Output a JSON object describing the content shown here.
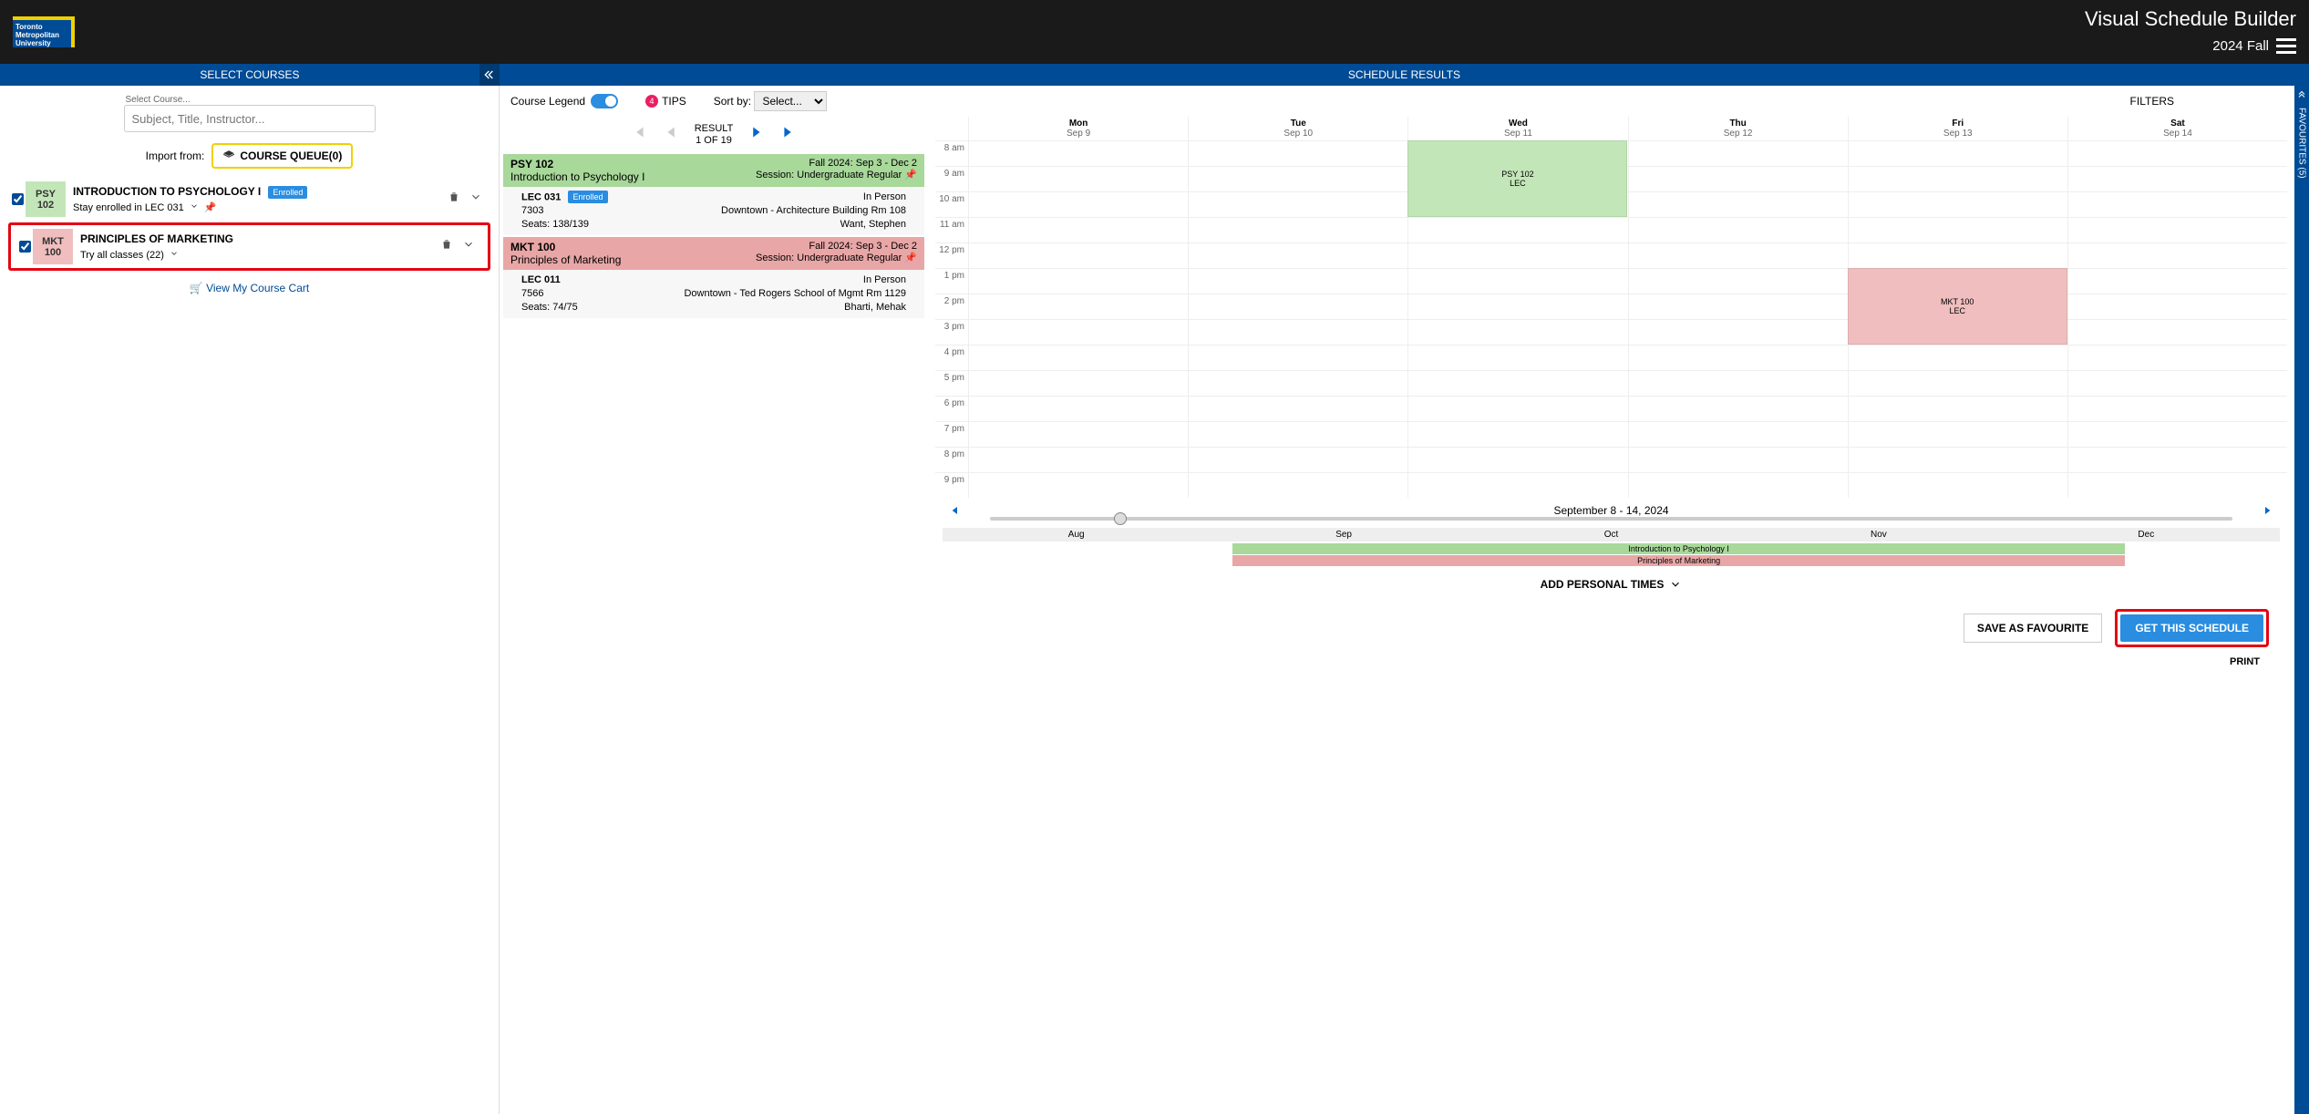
{
  "header": {
    "logo_text": "Toronto Metropolitan University",
    "app_title": "Visual Schedule Builder",
    "term": "2024 Fall"
  },
  "bluebar": {
    "left": "SELECT COURSES",
    "right": "SCHEDULE RESULTS"
  },
  "leftpanel": {
    "select_label": "Select Course...",
    "search_placeholder": "Subject, Title, Instructor...",
    "import_label": "Import from:",
    "queue_btn": "COURSE QUEUE(0)",
    "view_cart": "View My Course Cart",
    "courses": [
      {
        "code1": "PSY",
        "code2": "102",
        "title": "INTRODUCTION TO PSYCHOLOGY I",
        "enrolled": "Enrolled",
        "sub": "Stay enrolled in LEC 031",
        "badge": "badge-green"
      },
      {
        "code1": "MKT",
        "code2": "100",
        "title": "PRINCIPLES OF MARKETING",
        "enrolled": "",
        "sub": "Try all classes (22)",
        "badge": "badge-pink"
      }
    ]
  },
  "controls": {
    "legend": "Course Legend",
    "tips_count": "4",
    "tips": "TIPS",
    "sort_label": "Sort by:",
    "sort_value": "Select...",
    "filters": "FILTERS"
  },
  "pager": {
    "label": "RESULT",
    "count": "1 OF 19"
  },
  "sections": [
    {
      "head_class": "head-green",
      "code": "PSY 102",
      "name": "Introduction to Psychology I",
      "term": "Fall 2024: Sep 3 - Dec 2",
      "session": "Session: Undergraduate Regular",
      "sec": "LEC 031",
      "enrolled": "Enrolled",
      "num": "7303",
      "seats": "Seats: 138/139",
      "mode": "In Person",
      "loc": "Downtown - Architecture Building Rm 108",
      "instr": "Want, Stephen"
    },
    {
      "head_class": "head-pink",
      "code": "MKT 100",
      "name": "Principles of Marketing",
      "term": "Fall 2024: Sep 3 - Dec 2",
      "session": "Session: Undergraduate Regular",
      "sec": "LEC 011",
      "enrolled": "",
      "num": "7566",
      "seats": "Seats: 74/75",
      "mode": "In Person",
      "loc": "Downtown - Ted Rogers School of Mgmt Rm 1129",
      "instr": "Bharti, Mehak"
    }
  ],
  "calendar": {
    "days": [
      {
        "dow": "Mon",
        "dt": "Sep 9"
      },
      {
        "dow": "Tue",
        "dt": "Sep 10"
      },
      {
        "dow": "Wed",
        "dt": "Sep 11"
      },
      {
        "dow": "Thu",
        "dt": "Sep 12"
      },
      {
        "dow": "Fri",
        "dt": "Sep 13"
      },
      {
        "dow": "Sat",
        "dt": "Sep 14"
      }
    ],
    "hours": [
      "8 am",
      "9 am",
      "10 am",
      "11 am",
      "12 pm",
      "1 pm",
      "2 pm",
      "3 pm",
      "4 pm",
      "5 pm",
      "6 pm",
      "7 pm",
      "8 pm",
      "9 pm"
    ],
    "events": [
      {
        "class": "ev-green",
        "label1": "PSY 102",
        "label2": "LEC",
        "day": 2,
        "start": 0,
        "span": 3
      },
      {
        "class": "ev-pink",
        "label1": "MKT 100",
        "label2": "LEC",
        "day": 4,
        "start": 5,
        "span": 3
      }
    ]
  },
  "weeknav": {
    "label": "September 8 - 14, 2024",
    "months": [
      "Aug",
      "Sep",
      "Oct",
      "Nov",
      "Dec"
    ],
    "tl1": "Introduction to Psychology I",
    "tl2": "Principles of Marketing"
  },
  "bottom": {
    "add_personal": "ADD PERSONAL TIMES",
    "save_fav": "SAVE AS FAVOURITE",
    "get_sched": "GET THIS SCHEDULE",
    "print": "PRINT"
  },
  "favrail": "FAVOURITES (5)"
}
